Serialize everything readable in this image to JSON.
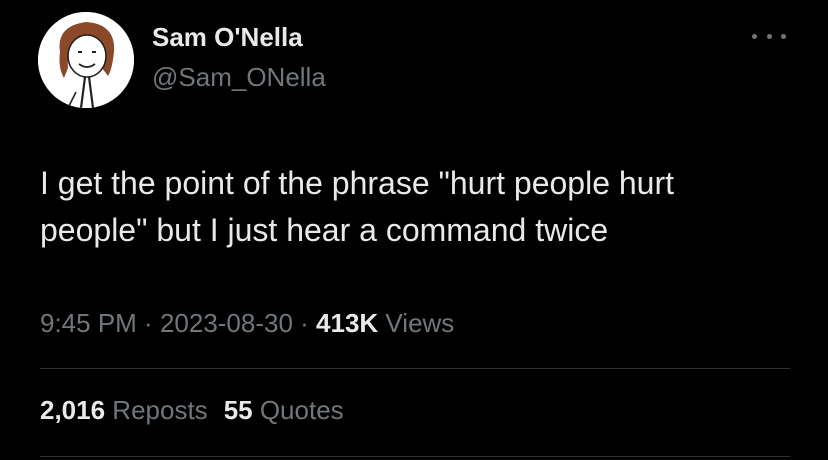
{
  "author": {
    "display_name": "Sam O'Nella",
    "handle": "@Sam_ONella"
  },
  "tweet": {
    "text_lines": [
      "I get the point of the phrase \"hurt people hurt",
      "people\" but I just hear a command twice"
    ]
  },
  "meta": {
    "time": "9:45 PM",
    "separator": " · ",
    "date": "2023-08-30",
    "views_count": "413K",
    "views_label": " Views"
  },
  "stats": {
    "reposts_count": "2,016",
    "reposts_label": " Reposts",
    "quotes_count": "55",
    "quotes_label": " Quotes"
  },
  "icons": {
    "more": "more-horizontal-icon"
  },
  "colors": {
    "background": "#000000",
    "primary_text": "#e7e9ea",
    "secondary_text": "#71767b",
    "divider": "#2f3336"
  }
}
